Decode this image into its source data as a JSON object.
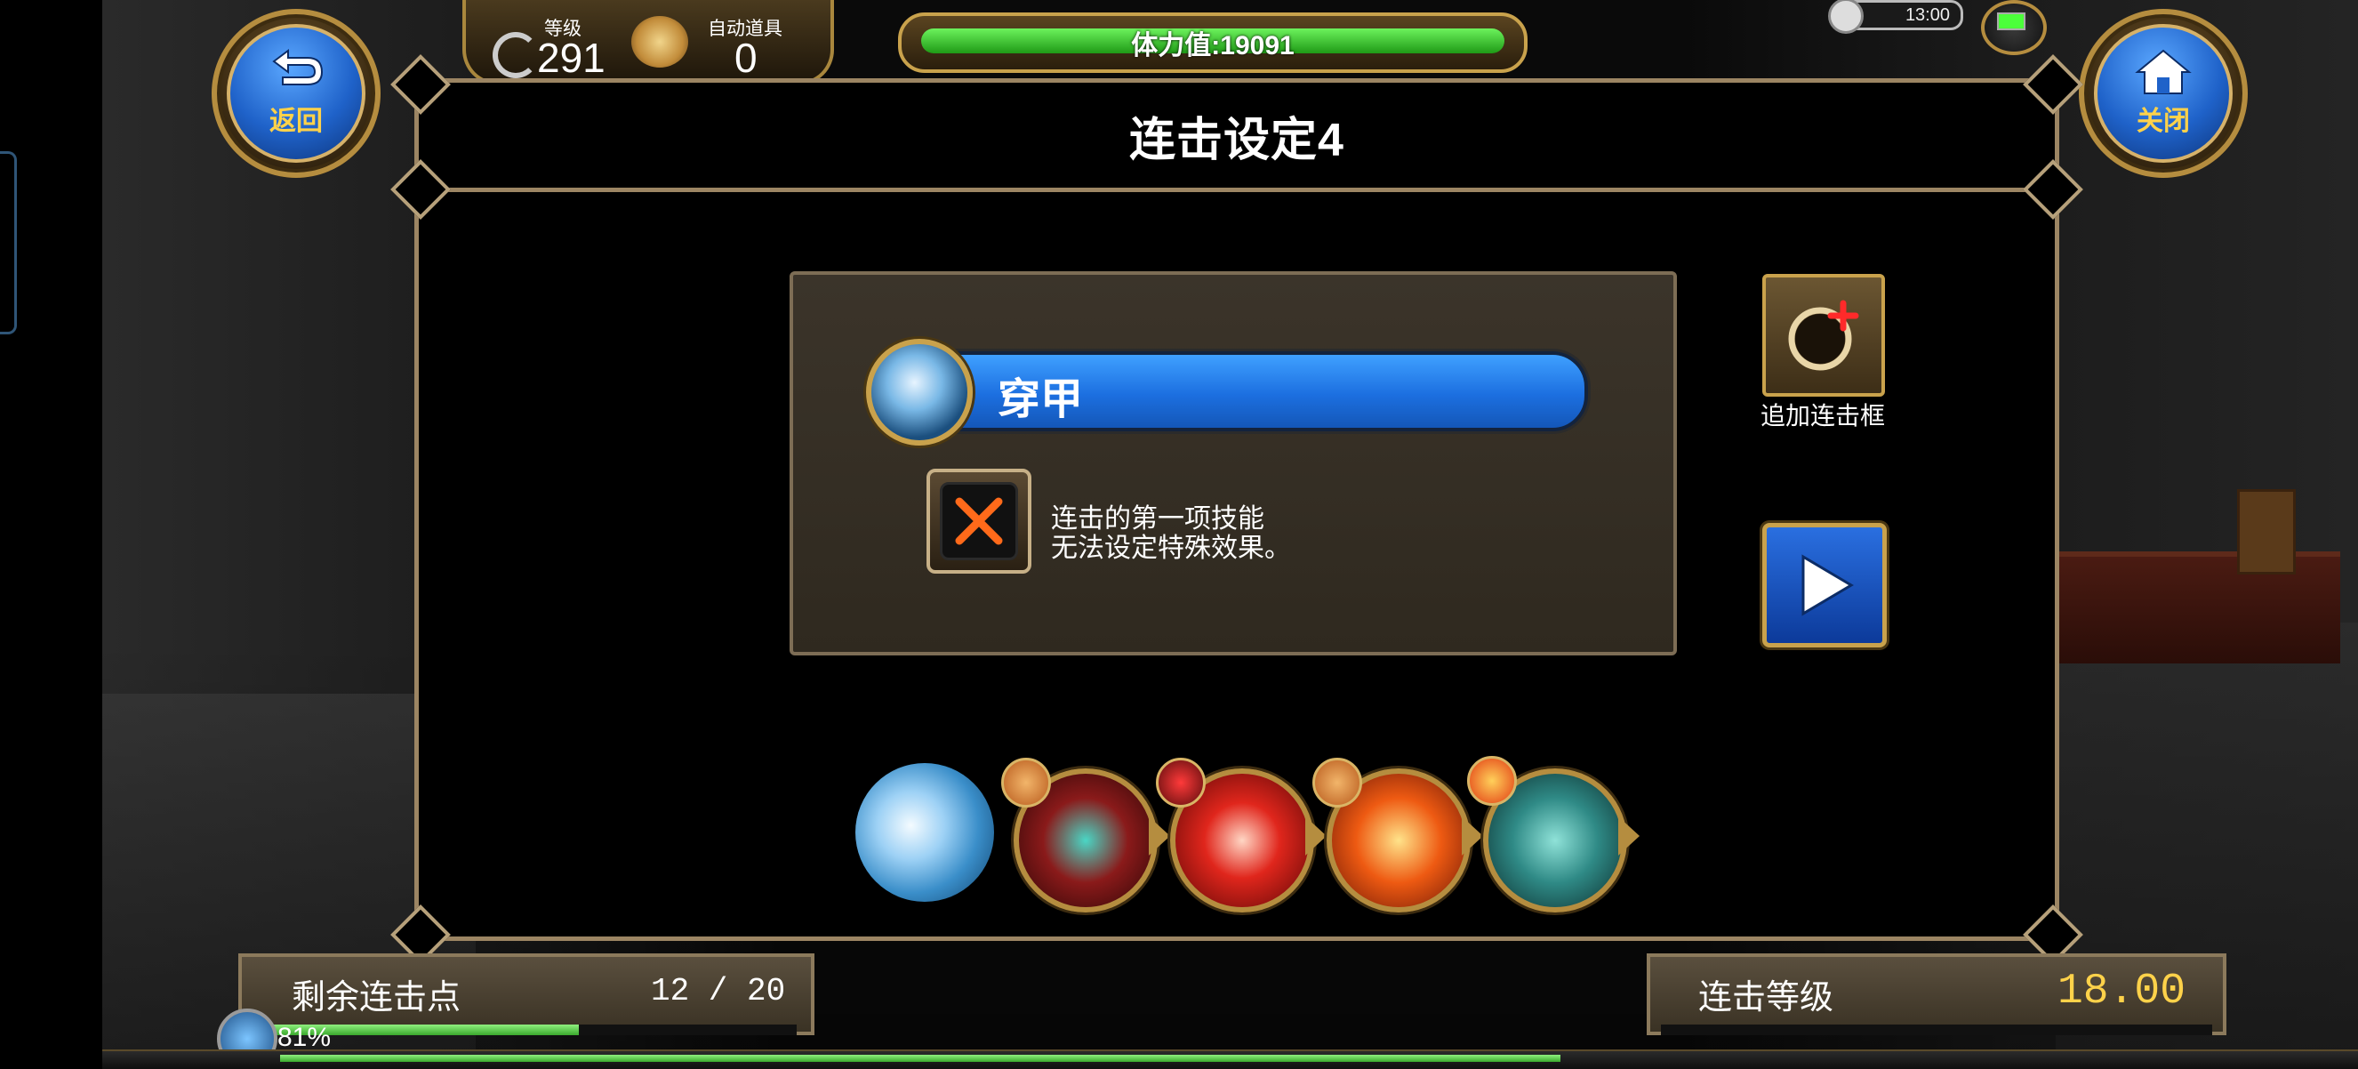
{
  "hud": {
    "level_caption": "等级",
    "level_value": "291",
    "auto_item_caption": "自动道具",
    "auto_item_value": "0",
    "stamina_text": "体力值:19091",
    "clock": "13:00"
  },
  "buttons": {
    "back_label": "返回",
    "close_label": "关闭"
  },
  "panel": {
    "title": "连击设定4",
    "selected_skill": "穿甲",
    "note_line1": "连击的第一项技能",
    "note_line2": "无法设定特殊效果。",
    "add_frame_label": "追加连击框"
  },
  "chain": {
    "skills": [
      {
        "icon": "armor-pierce-skill-icon",
        "color": "#6fb8e8"
      },
      {
        "icon": "red-slash-skill-icon",
        "color": "#8a1a1a"
      },
      {
        "icon": "fire-burst-skill-icon",
        "color": "#d7261c"
      },
      {
        "icon": "explosion-skill-icon",
        "color": "#e65a12"
      },
      {
        "icon": "wind-warrior-skill-icon",
        "color": "#2f8a86"
      }
    ]
  },
  "bottom": {
    "remaining_label": "剩余连击点",
    "remaining_value": "12 / 20",
    "remaining_fraction": 0.6,
    "combo_level_label": "连击等级",
    "combo_level_value": "18.00",
    "exp_text": "81%"
  },
  "colors": {
    "gold": "#c9a24c",
    "blue": "#1c6fe0",
    "accent_yellow": "#ffd24a",
    "stamina_green": "#3ed02a"
  }
}
